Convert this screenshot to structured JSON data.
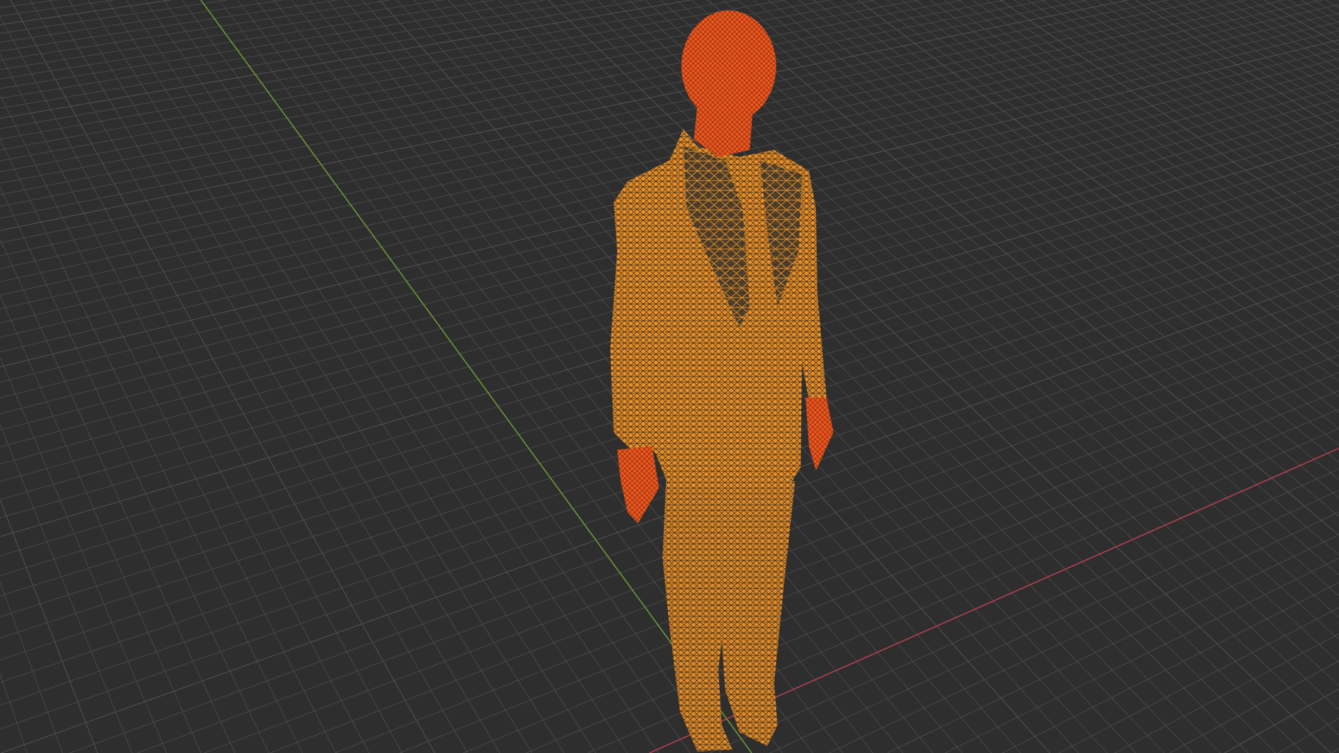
{
  "viewport": {
    "mode": "wireframe",
    "background_color": "#2e2e2e",
    "grid_color": "#4a4a4a",
    "x_axis_color": "#b8404f",
    "y_axis_color": "#6f9a3a",
    "selected_mesh_color": "#f5a23a",
    "active_mesh_color": "#ff5a1a"
  },
  "object": {
    "name_icon": "human-figure-mesh"
  }
}
